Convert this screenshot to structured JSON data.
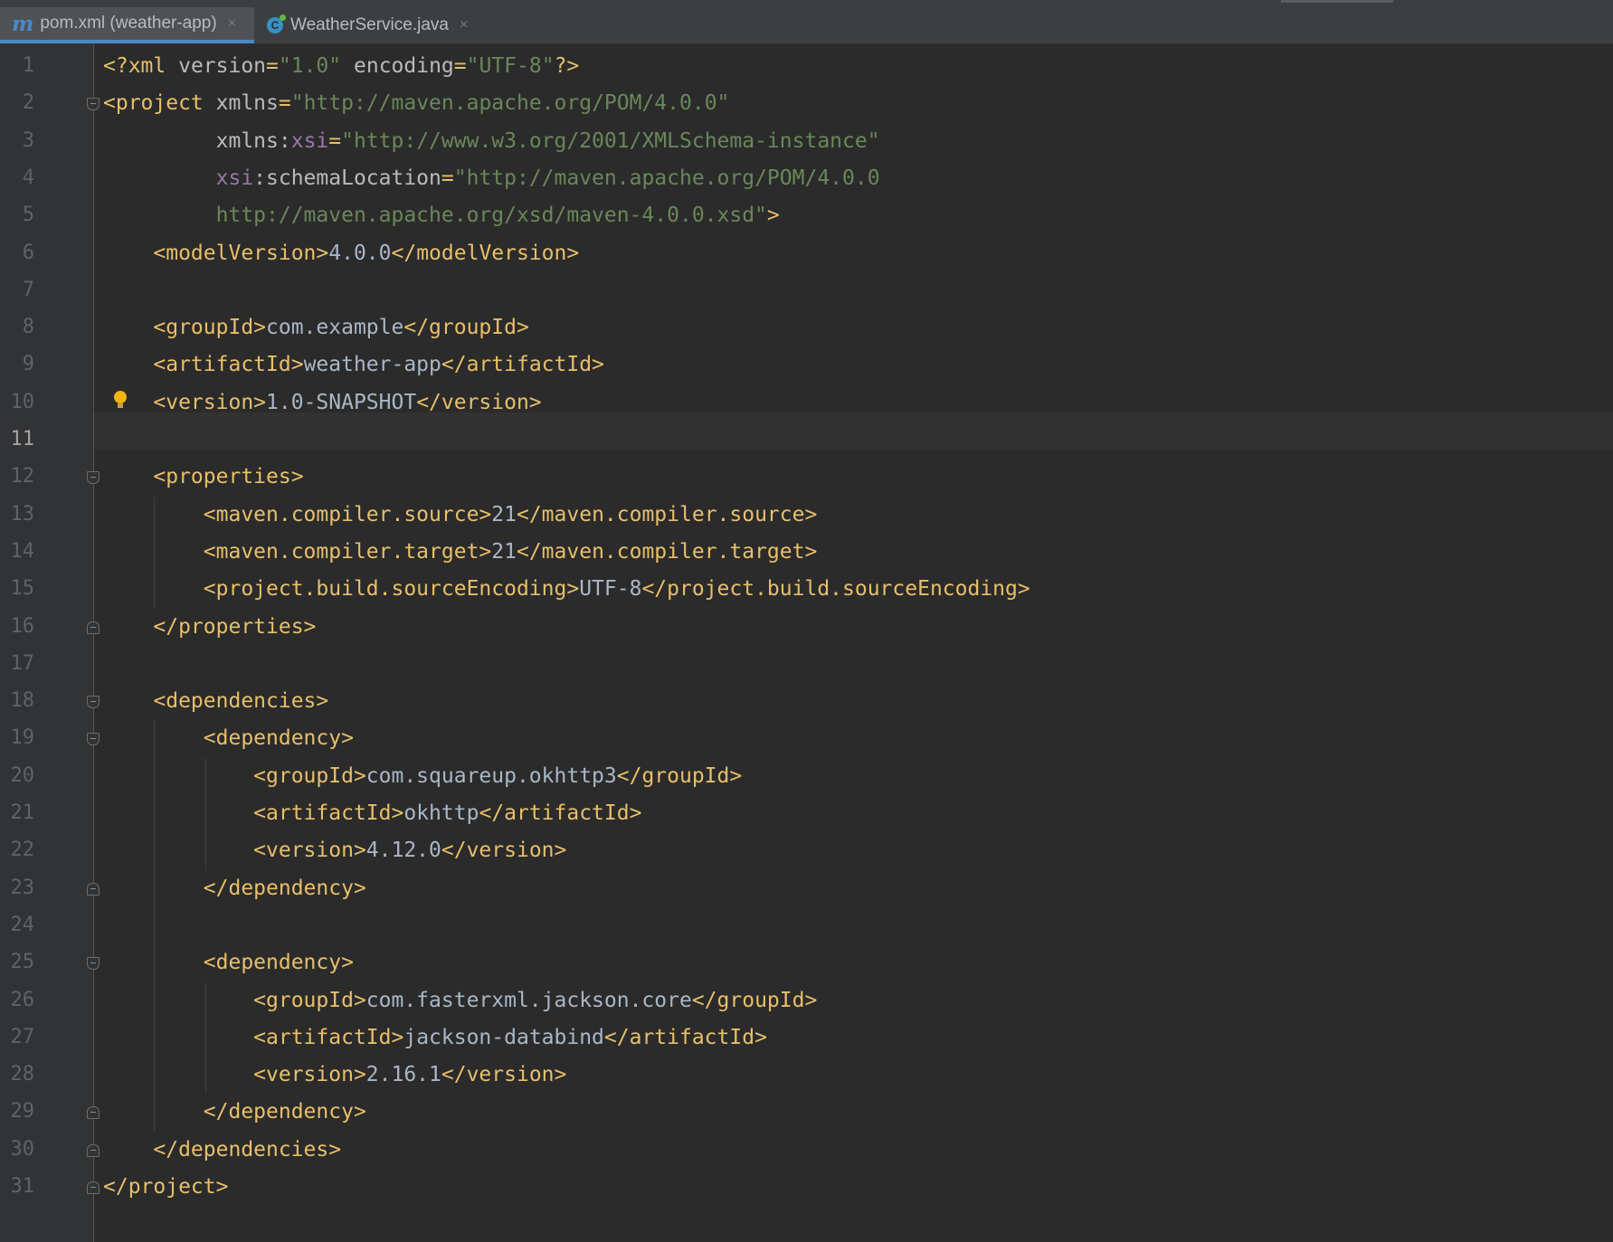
{
  "tabs": [
    {
      "label": "pom.xml (weather-app)",
      "icon": "maven-icon",
      "icon_glyph": "m",
      "active": true
    },
    {
      "label": "WeatherService.java",
      "icon": "java-class-icon",
      "icon_glyph": "C",
      "active": false
    }
  ],
  "tab_close_glyph": "×",
  "editor": {
    "current_line": 11,
    "intention_bulb_line": 10,
    "colors": {
      "tag": "#e8bf6a",
      "attribute": "#bababa",
      "namespace": "#9876aa",
      "value": "#6a8759",
      "text": "#a9b7c6",
      "background": "#2b2b2b",
      "accent": "#4a88c7"
    },
    "lines": [
      {
        "n": "1",
        "tokens": [
          {
            "t": "tag",
            "v": "<?xml "
          },
          {
            "t": "attr",
            "v": "version"
          },
          {
            "t": "tag",
            "v": "="
          },
          {
            "t": "val",
            "v": "\"1.0\""
          },
          {
            "t": "text",
            "v": " "
          },
          {
            "t": "attr",
            "v": "encoding"
          },
          {
            "t": "tag",
            "v": "="
          },
          {
            "t": "val",
            "v": "\"UTF-8\""
          },
          {
            "t": "tag",
            "v": "?>"
          }
        ]
      },
      {
        "n": "2",
        "tokens": [
          {
            "t": "tag",
            "v": "<project "
          },
          {
            "t": "attr",
            "v": "xmlns"
          },
          {
            "t": "tag",
            "v": "="
          },
          {
            "t": "val",
            "v": "\"http://maven.apache.org/POM/4.0.0\""
          }
        ]
      },
      {
        "n": "3",
        "tokens": [
          {
            "t": "text",
            "v": "         "
          },
          {
            "t": "attr",
            "v": "xmlns:"
          },
          {
            "t": "ns",
            "v": "xsi"
          },
          {
            "t": "tag",
            "v": "="
          },
          {
            "t": "val",
            "v": "\"http://www.w3.org/2001/XMLSchema-instance\""
          }
        ]
      },
      {
        "n": "4",
        "tokens": [
          {
            "t": "text",
            "v": "         "
          },
          {
            "t": "ns",
            "v": "xsi"
          },
          {
            "t": "attr",
            "v": ":schemaLocation"
          },
          {
            "t": "tag",
            "v": "="
          },
          {
            "t": "val",
            "v": "\"http://maven.apache.org/POM/4.0.0"
          }
        ]
      },
      {
        "n": "5",
        "tokens": [
          {
            "t": "text",
            "v": "         "
          },
          {
            "t": "val",
            "v": "http://maven.apache.org/xsd/maven-4.0.0.xsd\""
          },
          {
            "t": "tag",
            "v": ">"
          }
        ]
      },
      {
        "n": "6",
        "tokens": [
          {
            "t": "text",
            "v": "    "
          },
          {
            "t": "tag",
            "v": "<modelVersion>"
          },
          {
            "t": "text",
            "v": "4.0.0"
          },
          {
            "t": "tag",
            "v": "</modelVersion>"
          }
        ]
      },
      {
        "n": "7",
        "tokens": []
      },
      {
        "n": "8",
        "tokens": [
          {
            "t": "text",
            "v": "    "
          },
          {
            "t": "tag",
            "v": "<groupId>"
          },
          {
            "t": "text",
            "v": "com.example"
          },
          {
            "t": "tag",
            "v": "</groupId>"
          }
        ]
      },
      {
        "n": "9",
        "tokens": [
          {
            "t": "text",
            "v": "    "
          },
          {
            "t": "tag",
            "v": "<artifactId>"
          },
          {
            "t": "text",
            "v": "weather-app"
          },
          {
            "t": "tag",
            "v": "</artifactId>"
          }
        ]
      },
      {
        "n": "10",
        "tokens": [
          {
            "t": "text",
            "v": "    "
          },
          {
            "t": "tag",
            "v": "<version>"
          },
          {
            "t": "text",
            "v": "1.0-SNAPSHOT"
          },
          {
            "t": "tag",
            "v": "</version>"
          }
        ]
      },
      {
        "n": "11",
        "tokens": []
      },
      {
        "n": "12",
        "tokens": [
          {
            "t": "text",
            "v": "    "
          },
          {
            "t": "tag",
            "v": "<properties>"
          }
        ]
      },
      {
        "n": "13",
        "tokens": [
          {
            "t": "text",
            "v": "        "
          },
          {
            "t": "tag",
            "v": "<maven.compiler.source>"
          },
          {
            "t": "text",
            "v": "21"
          },
          {
            "t": "tag",
            "v": "</maven.compiler.source>"
          }
        ]
      },
      {
        "n": "14",
        "tokens": [
          {
            "t": "text",
            "v": "        "
          },
          {
            "t": "tag",
            "v": "<maven.compiler.target>"
          },
          {
            "t": "text",
            "v": "21"
          },
          {
            "t": "tag",
            "v": "</maven.compiler.target>"
          }
        ]
      },
      {
        "n": "15",
        "tokens": [
          {
            "t": "text",
            "v": "        "
          },
          {
            "t": "tag",
            "v": "<project.build.sourceEncoding>"
          },
          {
            "t": "text",
            "v": "UTF-8"
          },
          {
            "t": "tag",
            "v": "</project.build.sourceEncoding>"
          }
        ]
      },
      {
        "n": "16",
        "tokens": [
          {
            "t": "text",
            "v": "    "
          },
          {
            "t": "tag",
            "v": "</properties>"
          }
        ]
      },
      {
        "n": "17",
        "tokens": []
      },
      {
        "n": "18",
        "tokens": [
          {
            "t": "text",
            "v": "    "
          },
          {
            "t": "tag",
            "v": "<dependencies>"
          }
        ]
      },
      {
        "n": "19",
        "tokens": [
          {
            "t": "text",
            "v": "        "
          },
          {
            "t": "tag",
            "v": "<dependency>"
          }
        ]
      },
      {
        "n": "20",
        "tokens": [
          {
            "t": "text",
            "v": "            "
          },
          {
            "t": "tag",
            "v": "<groupId>"
          },
          {
            "t": "text",
            "v": "com.squareup.okhttp3"
          },
          {
            "t": "tag",
            "v": "</groupId>"
          }
        ]
      },
      {
        "n": "21",
        "tokens": [
          {
            "t": "text",
            "v": "            "
          },
          {
            "t": "tag",
            "v": "<artifactId>"
          },
          {
            "t": "text",
            "v": "okhttp"
          },
          {
            "t": "tag",
            "v": "</artifactId>"
          }
        ]
      },
      {
        "n": "22",
        "tokens": [
          {
            "t": "text",
            "v": "            "
          },
          {
            "t": "tag",
            "v": "<version>"
          },
          {
            "t": "text",
            "v": "4.12.0"
          },
          {
            "t": "tag",
            "v": "</version>"
          }
        ]
      },
      {
        "n": "23",
        "tokens": [
          {
            "t": "text",
            "v": "        "
          },
          {
            "t": "tag",
            "v": "</dependency>"
          }
        ]
      },
      {
        "n": "24",
        "tokens": []
      },
      {
        "n": "25",
        "tokens": [
          {
            "t": "text",
            "v": "        "
          },
          {
            "t": "tag",
            "v": "<dependency>"
          }
        ]
      },
      {
        "n": "26",
        "tokens": [
          {
            "t": "text",
            "v": "            "
          },
          {
            "t": "tag",
            "v": "<groupId>"
          },
          {
            "t": "text",
            "v": "com.fasterxml.jackson.core"
          },
          {
            "t": "tag",
            "v": "</groupId>"
          }
        ]
      },
      {
        "n": "27",
        "tokens": [
          {
            "t": "text",
            "v": "            "
          },
          {
            "t": "tag",
            "v": "<artifactId>"
          },
          {
            "t": "text",
            "v": "jackson-databind"
          },
          {
            "t": "tag",
            "v": "</artifactId>"
          }
        ]
      },
      {
        "n": "28",
        "tokens": [
          {
            "t": "text",
            "v": "            "
          },
          {
            "t": "tag",
            "v": "<version>"
          },
          {
            "t": "text",
            "v": "2.16.1"
          },
          {
            "t": "tag",
            "v": "</version>"
          }
        ]
      },
      {
        "n": "29",
        "tokens": [
          {
            "t": "text",
            "v": "        "
          },
          {
            "t": "tag",
            "v": "</dependency>"
          }
        ]
      },
      {
        "n": "30",
        "tokens": [
          {
            "t": "text",
            "v": "    "
          },
          {
            "t": "tag",
            "v": "</dependencies>"
          }
        ]
      },
      {
        "n": "31",
        "tokens": [
          {
            "t": "tag",
            "v": "</project>"
          }
        ]
      }
    ],
    "fold_markers": [
      {
        "line": 2,
        "kind": "open"
      },
      {
        "line": 12,
        "kind": "open"
      },
      {
        "line": 16,
        "kind": "close"
      },
      {
        "line": 18,
        "kind": "open"
      },
      {
        "line": 19,
        "kind": "open"
      },
      {
        "line": 23,
        "kind": "close"
      },
      {
        "line": 25,
        "kind": "open"
      },
      {
        "line": 29,
        "kind": "close"
      },
      {
        "line": 30,
        "kind": "close"
      },
      {
        "line": 31,
        "kind": "close"
      }
    ]
  }
}
